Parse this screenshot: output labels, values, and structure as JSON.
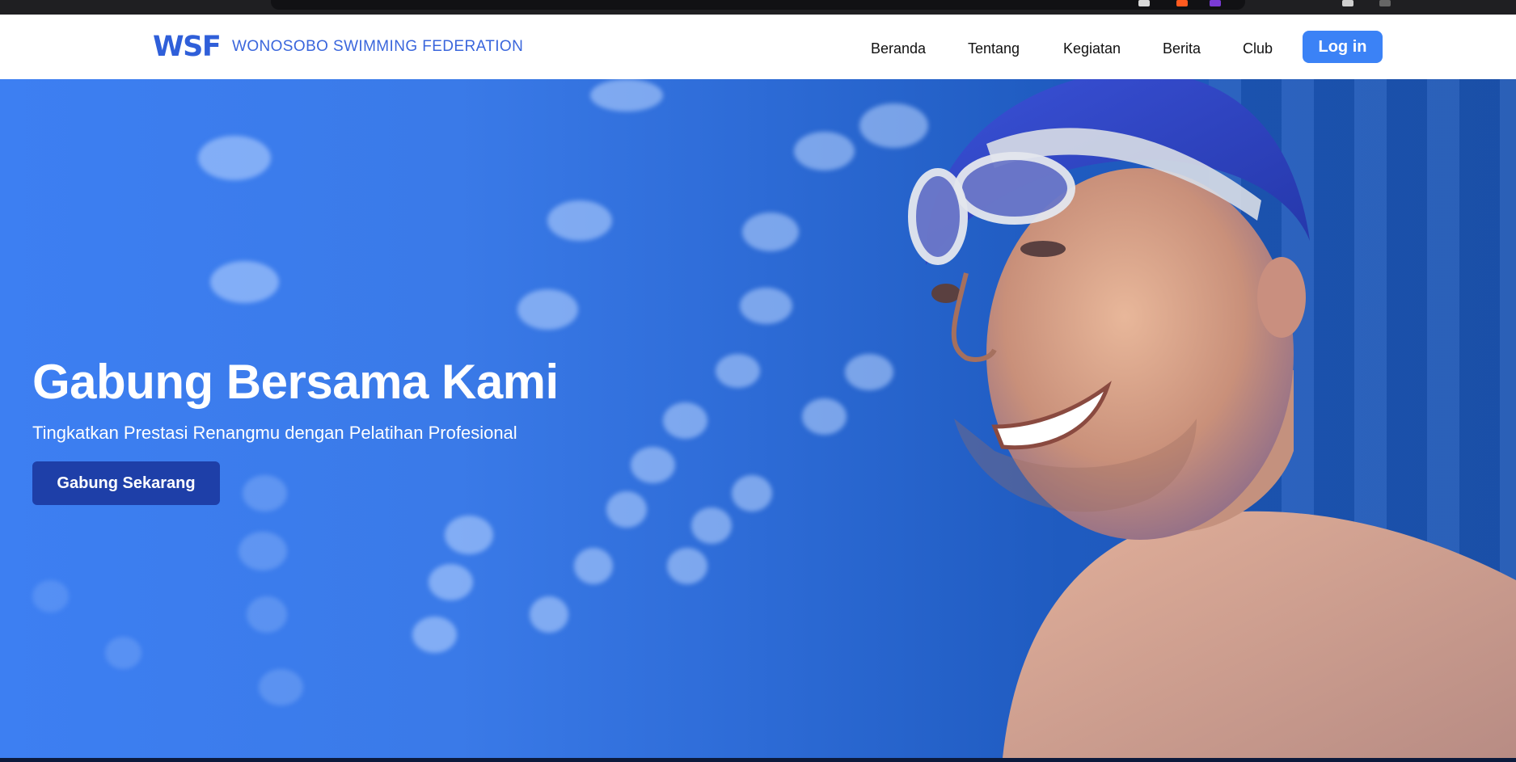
{
  "navbar": {
    "logo": "WSF",
    "brand_name": "WONOSOBO SWIMMING FEDERATION",
    "links": [
      {
        "label": "Beranda"
      },
      {
        "label": "Tentang"
      },
      {
        "label": "Kegiatan"
      },
      {
        "label": "Berita"
      },
      {
        "label": "Club"
      }
    ],
    "login_label": "Log in"
  },
  "hero": {
    "title": "Gabung Bersama Kami",
    "subtitle": "Tingkatkan Prestasi Renangmu dengan Pelatihan Profesional",
    "cta_label": "Gabung Sekarang"
  },
  "colors": {
    "brand": "#2f5fd9",
    "login_button": "#3b82f6",
    "cta_button": "#1e3fa8",
    "hero_background": "#3d7ff2"
  }
}
